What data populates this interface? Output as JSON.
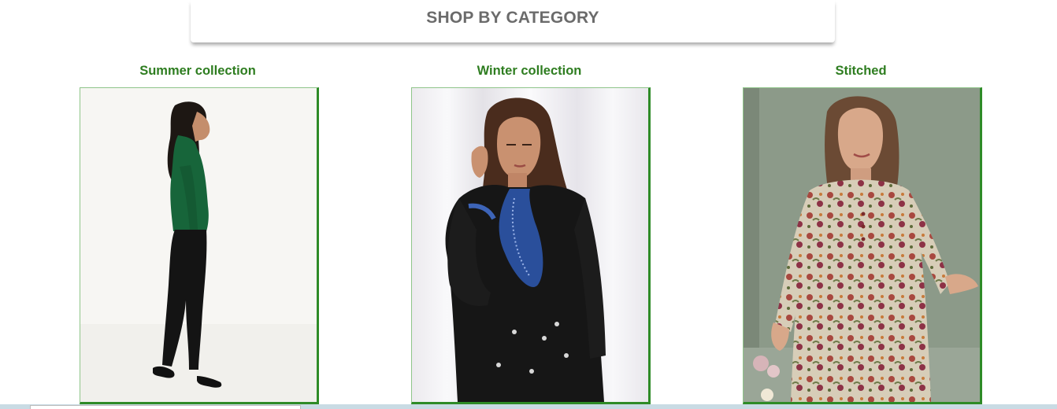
{
  "section": {
    "title": "SHOP BY CATEGORY"
  },
  "categories": [
    {
      "label": "Summer collection",
      "image": "woman-green-sweater-black-pants-side-view"
    },
    {
      "label": "Winter collection",
      "image": "woman-black-embroidered-kurta"
    },
    {
      "label": "Stitched",
      "image": "woman-floral-printed-kurta"
    }
  ],
  "colors": {
    "heading_text": "#6b6b6b",
    "category_title": "#2e7d20",
    "card_border_accent": "#2e8b27"
  }
}
